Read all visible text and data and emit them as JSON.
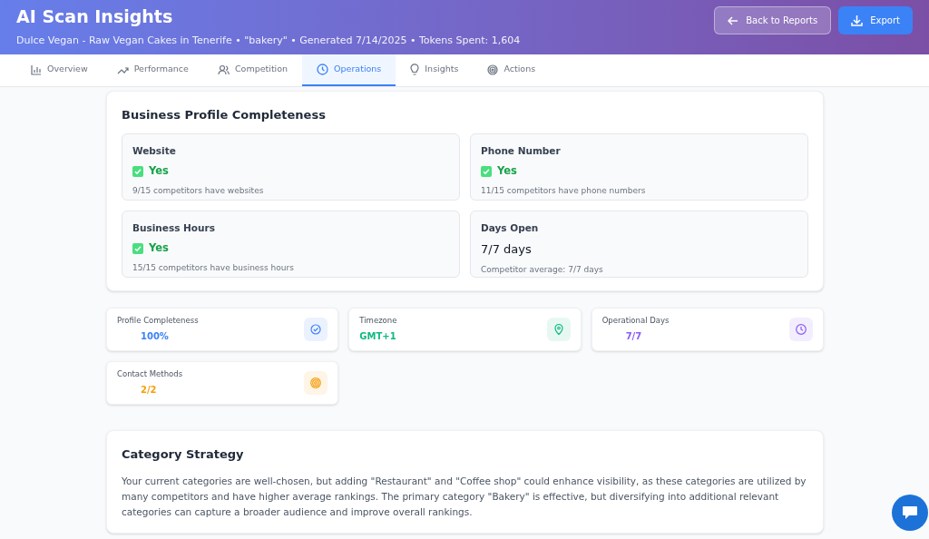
{
  "header": {
    "title": "AI Scan Insights",
    "subtitle": "Dulce Vegan - Raw Vegan Cakes in Tenerife • \"bakery\" • Generated 7/14/2025 • Tokens Spent: 1,604",
    "buttons": [
      "Back to Reports",
      "Export"
    ]
  },
  "tabs": [
    {
      "label": "Overview",
      "selected": false
    },
    {
      "label": "Performance",
      "selected": false
    },
    {
      "label": "Competition",
      "selected": false
    },
    {
      "label": "Operations",
      "selected": true
    },
    {
      "label": "Insights",
      "selected": false
    },
    {
      "label": "Actions",
      "selected": false
    }
  ],
  "profile": {
    "title": "Business Profile Completeness",
    "items": [
      {
        "kind": "check",
        "label": "Website",
        "value": "Yes",
        "checked": true,
        "note": "9/15 competitors have websites"
      },
      {
        "kind": "check",
        "label": "Phone Number",
        "value": "Yes",
        "checked": true,
        "note": "11/15 competitors have phone numbers"
      },
      {
        "kind": "check",
        "label": "Business Hours",
        "value": "Yes",
        "checked": true,
        "note": "15/15 competitors have business hours"
      },
      {
        "kind": "text",
        "label": "Days Open",
        "value": "7/7 days",
        "note": "Competitor average: 7/7 days"
      }
    ]
  },
  "stats": [
    {
      "label": "Profile Completeness",
      "value": "100%",
      "color": "#3b82f6"
    },
    {
      "label": "Timezone",
      "value": "GMT+1",
      "color": "#10b981"
    },
    {
      "label": "Operational Days",
      "value": "7/7",
      "color": "#8b5cf6"
    },
    {
      "label": "Contact Methods",
      "value": "2/2",
      "color": "#f59e0b"
    }
  ],
  "category_strategy": {
    "title": "Category Strategy",
    "text": "Your current categories are well-chosen, but adding \"Restaurant\" and \"Coffee shop\" could enhance visibility, as these categories are utilized by many competitors and have higher average rankings. The primary category \"Bakery\" is effective, but diversifying into additional relevant categories can capture a broader audience and improve overall rankings."
  }
}
